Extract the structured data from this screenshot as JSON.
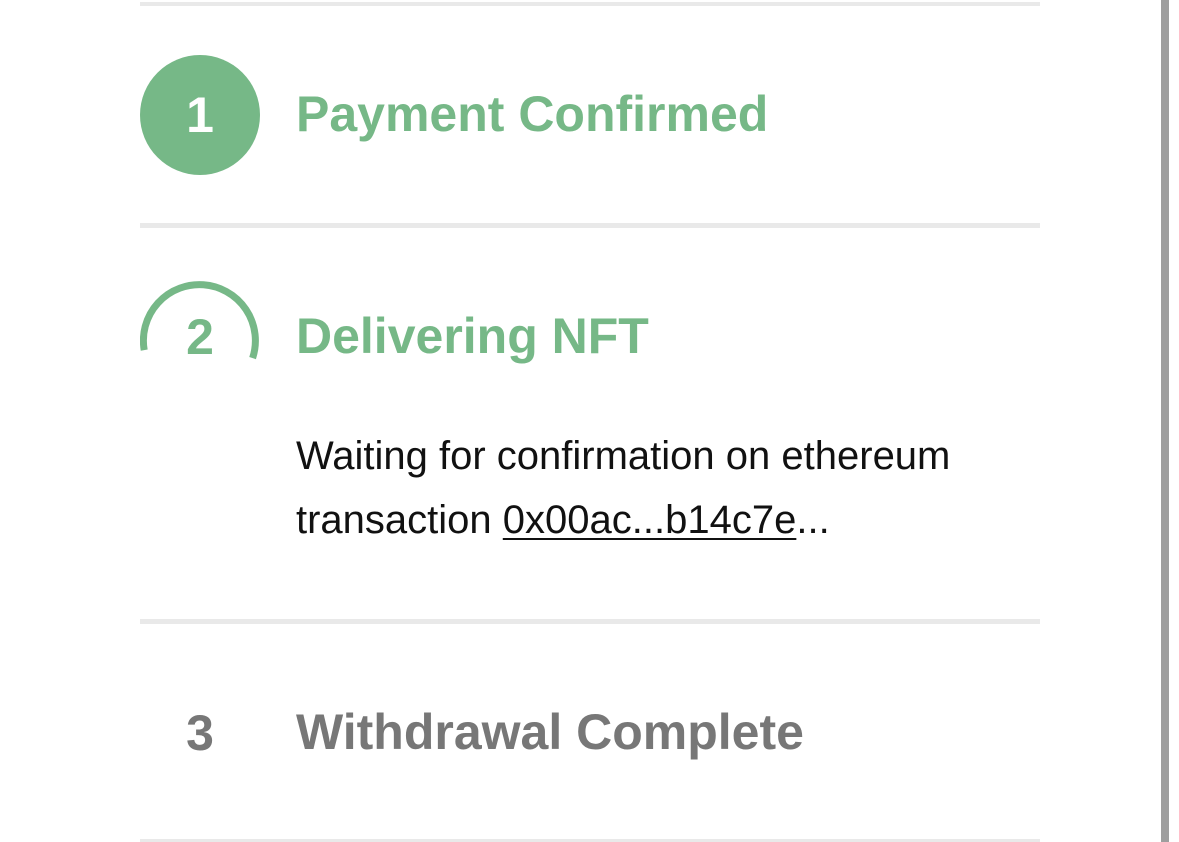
{
  "steps": [
    {
      "number": "1",
      "title": "Payment Confirmed",
      "status": "complete"
    },
    {
      "number": "2",
      "title": "Delivering NFT",
      "status": "in-progress",
      "description_line1": "Waiting for confirmation on ethereum",
      "description_prefix": "transaction ",
      "tx_hash": "0x00ac...b14c7e",
      "description_suffix": "..."
    },
    {
      "number": "3",
      "title": "Withdrawal Complete",
      "status": "pending"
    }
  ],
  "colors": {
    "accent_green": "#76b887",
    "pending_gray": "#777777",
    "divider": "#e9e9e9",
    "text": "#111111"
  },
  "icons": {
    "step_1": "filled-circle",
    "step_2": "loading-spinner-arc"
  }
}
